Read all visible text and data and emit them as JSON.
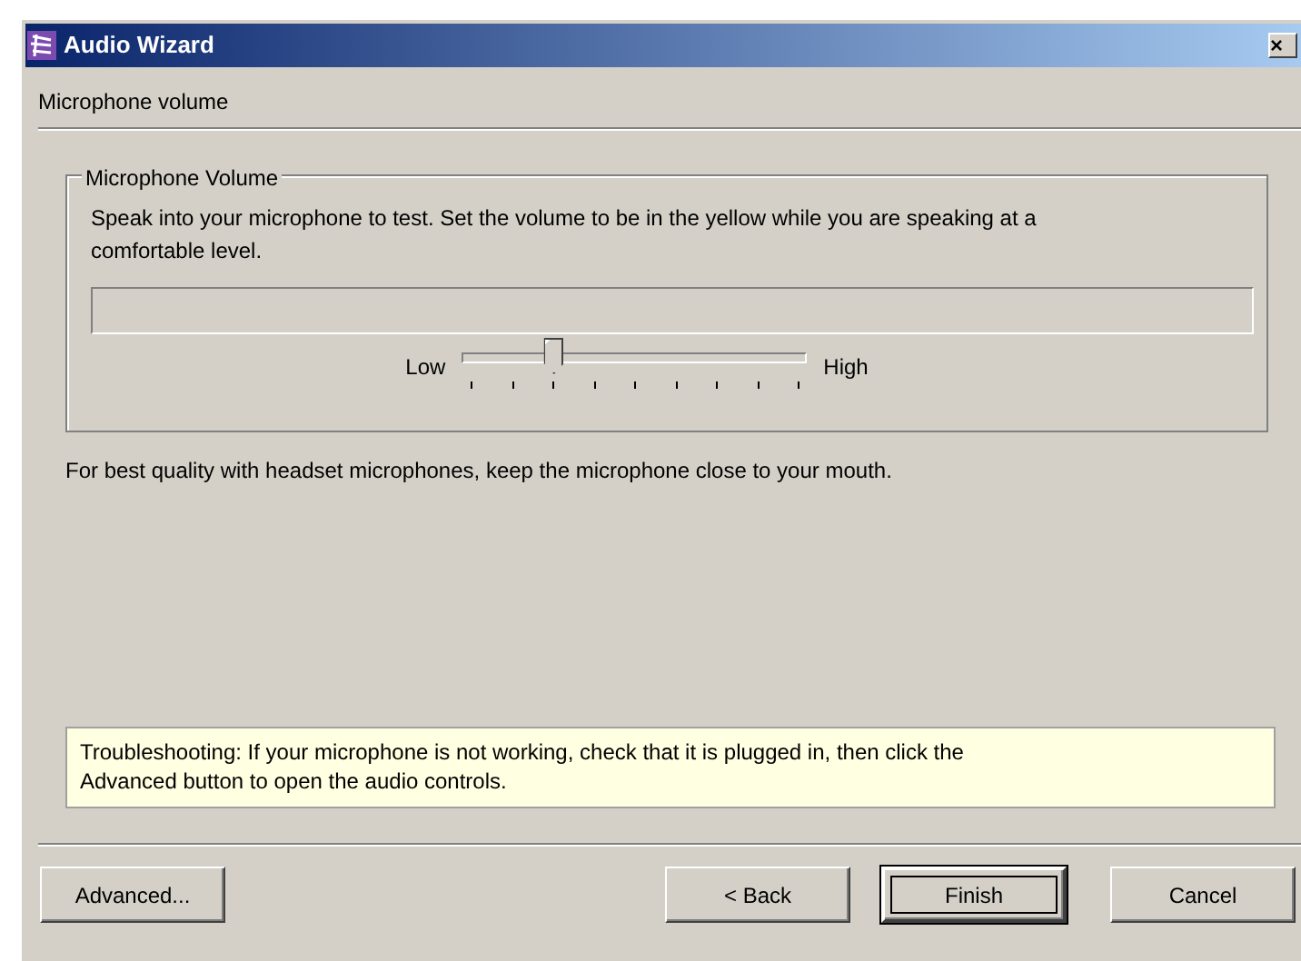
{
  "window": {
    "title": "Audio Wizard",
    "close": "×"
  },
  "header": {
    "title": "Microphone volume"
  },
  "group": {
    "legend": "Microphone Volume",
    "instructions": "Speak into your microphone to test. Set the volume to be in the yellow while you are speaking at a comfortable level.",
    "slider": {
      "low_label": "Low",
      "high_label": "High",
      "level": 0.25
    }
  },
  "note": "For best quality with headset microphones, keep the microphone close to your mouth.",
  "troubleshooting": "Troubleshooting: If your microphone is not working, check that it is plugged in, then click the Advanced button to open the audio controls.",
  "buttons": [
    {
      "label": "Advanced...",
      "focused": false
    },
    {
      "label": "< Back",
      "focused": false
    },
    {
      "label": "Finish",
      "focused": true
    },
    {
      "label": "Cancel",
      "focused": false
    }
  ]
}
